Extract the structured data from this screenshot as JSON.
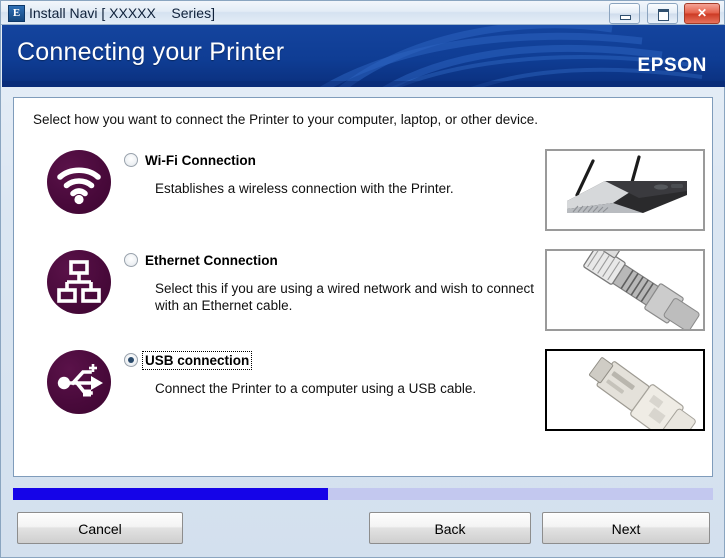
{
  "window": {
    "title": "Install Navi [ XXXXX    Series]",
    "app_icon": "epson-e-icon",
    "controls": {
      "minimize": "minimize-icon",
      "maximize": "maximize-icon",
      "close": "✕"
    }
  },
  "header": {
    "title": "Connecting your Printer",
    "brand": "EPSON",
    "brand_color": "#ffffff",
    "background_color": "#10459b"
  },
  "main": {
    "instruction": "Select how you want to connect the Printer to your computer, laptop, or other device.",
    "options": [
      {
        "id": "wifi",
        "label": "Wi-Fi Connection",
        "description": "Establishes a wireless connection with the Printer.",
        "selected": false,
        "icon": "wifi-icon",
        "icon_color": "#48093a",
        "photo": "wireless-router-photo",
        "photo_border": "#9a9a9a"
      },
      {
        "id": "ethernet",
        "label": "Ethernet Connection",
        "description": "Select this if you are using a wired network and wish to connect with an Ethernet cable.",
        "selected": false,
        "icon": "ethernet-icon",
        "icon_color": "#48093a",
        "photo": "ethernet-cable-photo",
        "photo_border": "#9a9a9a"
      },
      {
        "id": "usb",
        "label": "USB connection",
        "description": "Connect the Printer to a computer using a USB cable.",
        "selected": true,
        "icon": "usb-icon",
        "icon_color": "#48093a",
        "photo": "usb-connector-photo",
        "photo_border": "#000000"
      }
    ]
  },
  "progress": {
    "percent": 45,
    "fill_color": "#1504e8",
    "track_color": "#c3c8ef"
  },
  "footer": {
    "cancel_label": "Cancel",
    "back_label": "Back",
    "next_label": "Next"
  }
}
